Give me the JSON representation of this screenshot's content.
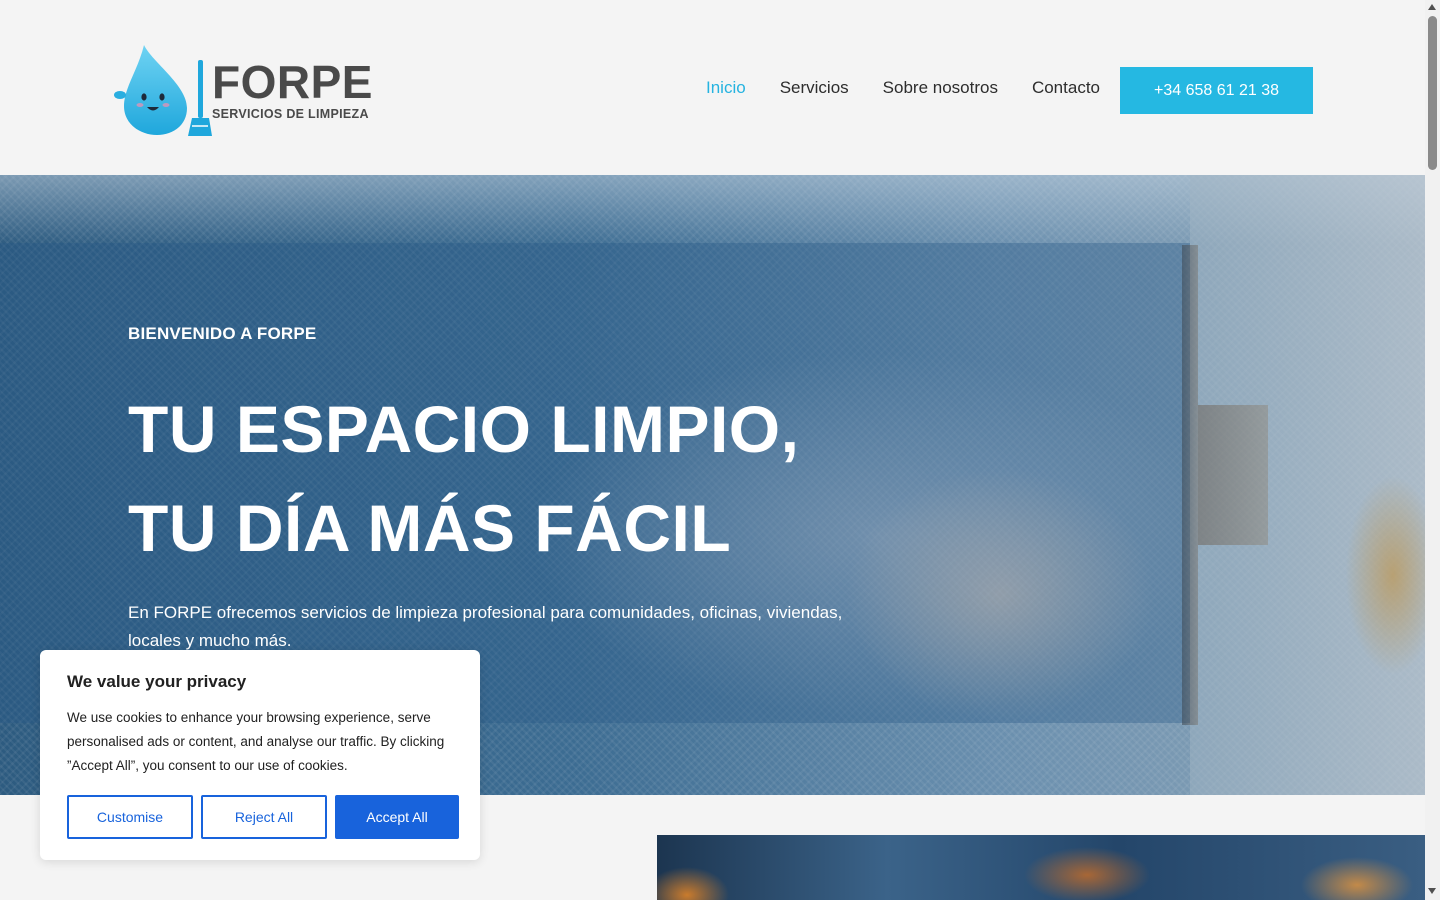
{
  "header": {
    "logo": {
      "title": "FORPE",
      "subtitle": "SERVICIOS DE LIMPIEZA",
      "icon": "water-drop-mascot-with-broom"
    },
    "nav": {
      "items": [
        {
          "label": "Inicio",
          "active": true
        },
        {
          "label": "Servicios",
          "active": false
        },
        {
          "label": "Sobre nosotros",
          "active": false
        },
        {
          "label": "Contacto",
          "active": false
        }
      ]
    },
    "phone_button": "+34 658 61 21 38"
  },
  "hero": {
    "eyebrow": "BIENVENIDO A FORPE",
    "title_line1": "TU ESPACIO LIMPIO,",
    "title_line2": "TU DÍA MÁS FÁCIL",
    "description": "En FORPE ofrecemos servicios de limpieza profesional para comunidades, oficinas, viviendas, locales y mucho más."
  },
  "cookie_banner": {
    "title": "We value your privacy",
    "text": "We use cookies to enhance your browsing experience, serve personalised ads or content, and analyse our traffic. By clicking ”Accept All”, you consent to our use of cookies.",
    "customise_label": "Customise",
    "reject_label": "Reject All",
    "accept_label": "Accept All"
  },
  "colors": {
    "accent": "#25b8e2",
    "nav_active": "#25b3e0",
    "cookie_primary": "#1863dc",
    "background": "#f4f4f4",
    "text": "#2d2d2d"
  }
}
